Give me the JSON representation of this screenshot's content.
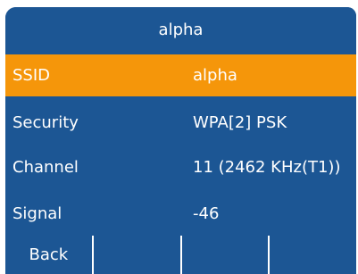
{
  "header": {
    "title": "alpha"
  },
  "rows": [
    {
      "label": "SSID",
      "value": "alpha",
      "selected": true
    },
    {
      "label": "Security",
      "value": "WPA[2] PSK",
      "selected": false
    },
    {
      "label": "Channel",
      "value": "11 (2462 KHz(T1))",
      "selected": false
    },
    {
      "label": "Signal",
      "value": "-46",
      "selected": false
    }
  ],
  "softkeys": [
    "Back",
    "",
    "",
    ""
  ],
  "colors": {
    "panel": "#1c5694",
    "highlight": "#f5960a",
    "text": "#ffffff"
  }
}
